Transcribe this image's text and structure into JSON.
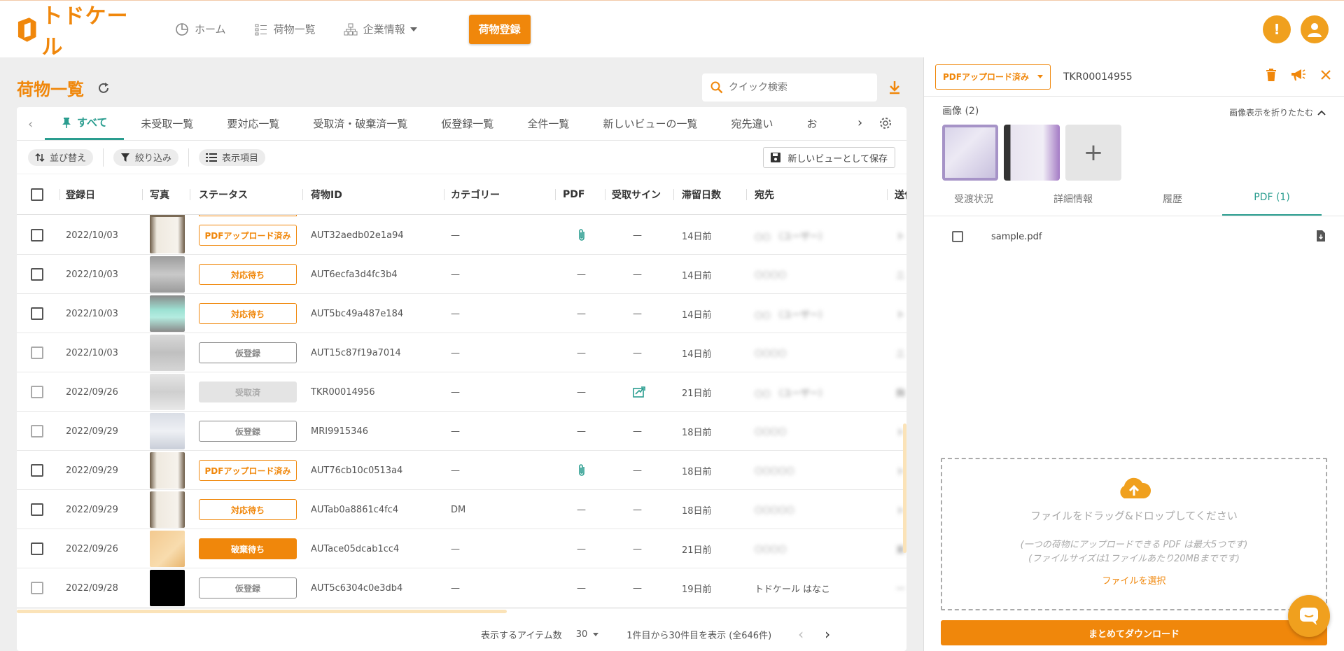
{
  "app": {
    "brand": "トドケール",
    "nav": {
      "home": "ホーム",
      "list": "荷物一覧",
      "company": "企業情報"
    },
    "register_button": "荷物登録"
  },
  "list": {
    "title": "荷物一覧",
    "search_placeholder": "クイック検索",
    "tabs": [
      "すべて",
      "未受取一覧",
      "要対応一覧",
      "受取済・破棄済一覧",
      "仮登録一覧",
      "全件一覧",
      "新しいビューの一覧",
      "宛先違い",
      "お"
    ],
    "toolbar": {
      "sort": "並び替え",
      "filter": "絞り込み",
      "columns": "表示項目",
      "save_view": "新しいビューとして保存"
    },
    "headers": {
      "date": "登録日",
      "photo": "写真",
      "status": "ステータス",
      "id": "荷物ID",
      "category": "カテゴリー",
      "pdf": "PDF",
      "sign": "受取サイン",
      "days": "滞留日数",
      "to": "宛先",
      "sender": "送付"
    },
    "rows": [
      {
        "date": "2022/10/03",
        "status": "PDFアップロード済み",
        "id": "AUT32aedb02e1a94",
        "category": "—",
        "pdf": "clip",
        "sign": "—",
        "days": "14日前",
        "to": "○○ （ユーザー）",
        "sender": "ト"
      },
      {
        "date": "2022/10/03",
        "status": "対応待ち",
        "id": "AUT6ecfa3d4fc3b4",
        "category": "—",
        "pdf": "—",
        "sign": "—",
        "days": "14日前",
        "to": "○○○○",
        "sender": "ニ"
      },
      {
        "date": "2022/10/03",
        "status": "対応待ち",
        "id": "AUT5bc49a487e184",
        "category": "—",
        "pdf": "—",
        "sign": "—",
        "days": "14日前",
        "to": "○○ （ユーザー）",
        "sender": "ト"
      },
      {
        "date": "2022/10/03",
        "status": "仮登録",
        "id": "AUT15c87f19a7014",
        "category": "—",
        "pdf": "—",
        "sign": "—",
        "days": "14日前",
        "to": "○○○○",
        "sender": "ニ"
      },
      {
        "date": "2022/09/26",
        "status": "受取済",
        "id": "TKR00014956",
        "category": "—",
        "pdf": "—",
        "sign": "sign",
        "days": "21日前",
        "to": "○○ （ユーザー）",
        "sender": "麹"
      },
      {
        "date": "2022/09/29",
        "status": "仮登録",
        "id": "MRI9915346",
        "category": "—",
        "pdf": "—",
        "sign": "—",
        "days": "18日前",
        "to": "○○○○",
        "sender": "ト"
      },
      {
        "date": "2022/09/29",
        "status": "PDFアップロード済み",
        "id": "AUT76cb10c0513a4",
        "category": "—",
        "pdf": "clip",
        "sign": "—",
        "days": "18日前",
        "to": "○○○○○",
        "sender": "ト"
      },
      {
        "date": "2022/09/29",
        "status": "対応待ち",
        "id": "AUTab0a8861c4fc4",
        "category": "DM",
        "pdf": "—",
        "sign": "—",
        "days": "18日前",
        "to": "○○○○○",
        "sender": "ト"
      },
      {
        "date": "2022/09/26",
        "status": "破棄待ち",
        "id": "AUTace05dcab1cc4",
        "category": "—",
        "pdf": "—",
        "sign": "—",
        "days": "21日前",
        "to": "○○○○",
        "sender": "東"
      },
      {
        "date": "2022/09/28",
        "status": "仮登録",
        "id": "AUT5c6304c0e3db4",
        "category": "—",
        "pdf": "—",
        "sign": "—",
        "days": "19日前",
        "to": "トドケール はなこ",
        "sender": "—"
      }
    ],
    "footer": {
      "per_page_label": "表示するアイテム数",
      "per_page": "30",
      "range": "1件目から30件目を表示 (全646件)"
    }
  },
  "detail": {
    "status": "PDFアップロード済み",
    "id": "TKR00014955",
    "images_label": "画像 (2)",
    "collapse_label": "画像表示を折りたたむ",
    "tabs": [
      "受渡状況",
      "詳細情報",
      "履歴",
      "PDF (1)"
    ],
    "file_name": "sample.pdf",
    "drop_title": "ファイルをドラッグ&ドロップしてください",
    "drop_note1": "(一つの荷物にアップロードできる PDF は最大5つです)",
    "drop_note2": "(ファイルサイズは1ファイルあたり20MBまでです)",
    "drop_select": "ファイルを選択",
    "bulk_download": "まとめてダウンロード"
  },
  "colors": {
    "brand_orange": "#f0870b",
    "accent_teal": "#2a9d8f",
    "badge_yellow": "#f0a01e"
  }
}
